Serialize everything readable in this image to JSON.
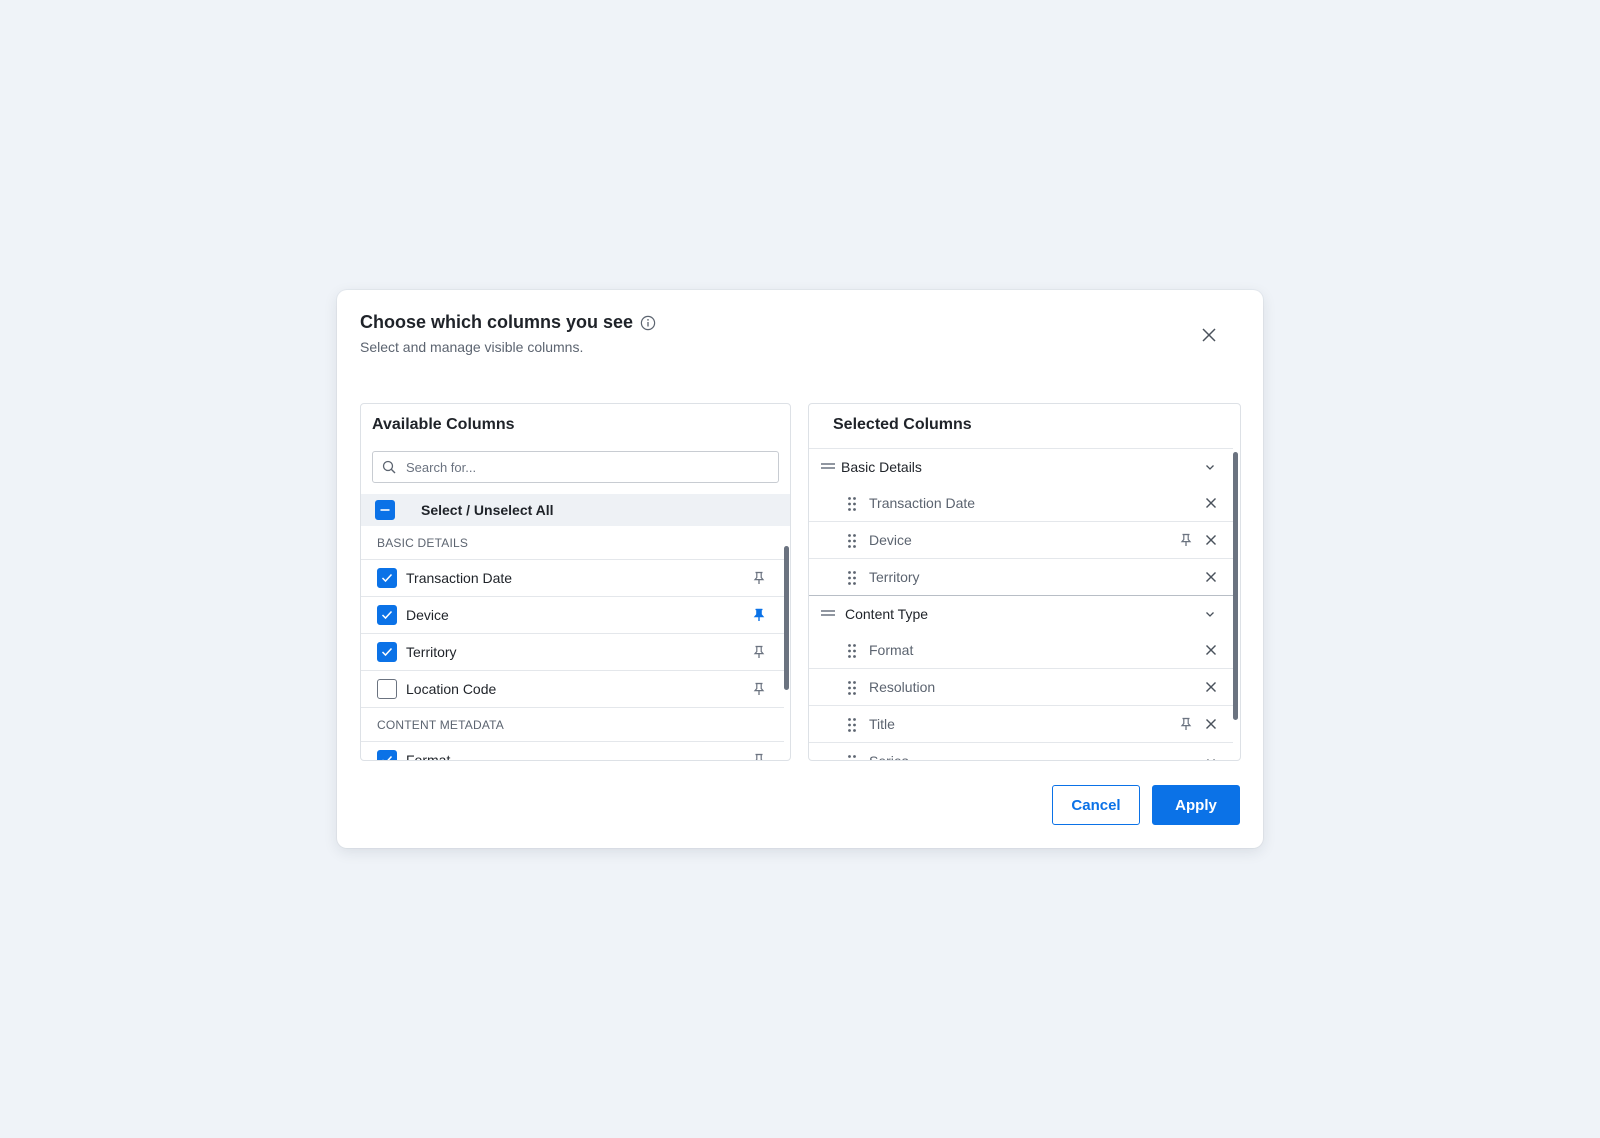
{
  "modal": {
    "title": "Choose which columns you see",
    "subtitle": "Select and manage visible columns."
  },
  "available": {
    "title": "Available Columns",
    "search_placeholder": "Search for...",
    "select_all_label": "Select  / Unselect All",
    "select_all_state": "indeterminate",
    "groups": [
      {
        "header": "BASIC DETAILS",
        "items": [
          {
            "label": "Transaction Date",
            "checked": true,
            "pinned": false
          },
          {
            "label": "Device",
            "checked": true,
            "pinned": true
          },
          {
            "label": "Territory",
            "checked": true,
            "pinned": false
          },
          {
            "label": "Location Code",
            "checked": false,
            "pinned": false
          }
        ]
      },
      {
        "header": "CONTENT METADATA",
        "items": [
          {
            "label": "Format",
            "checked": true,
            "pinned": false
          }
        ]
      }
    ]
  },
  "selected": {
    "title": "Selected Columns",
    "groups": [
      {
        "label": "Basic Details",
        "items": [
          {
            "label": "Transaction Date",
            "pinned": false
          },
          {
            "label": "Device",
            "pinned": true
          },
          {
            "label": "Territory",
            "pinned": false
          }
        ]
      },
      {
        "label": "Content Type",
        "items": [
          {
            "label": "Format",
            "pinned": false
          },
          {
            "label": "Resolution",
            "pinned": false
          },
          {
            "label": "Title",
            "pinned": true
          },
          {
            "label": "Series",
            "pinned": false
          }
        ]
      }
    ]
  },
  "footer": {
    "cancel_label": "Cancel",
    "apply_label": "Apply"
  },
  "colors": {
    "accent": "#0b72e7",
    "background": "#eff3f8",
    "icon_gray": "#6b7380"
  }
}
